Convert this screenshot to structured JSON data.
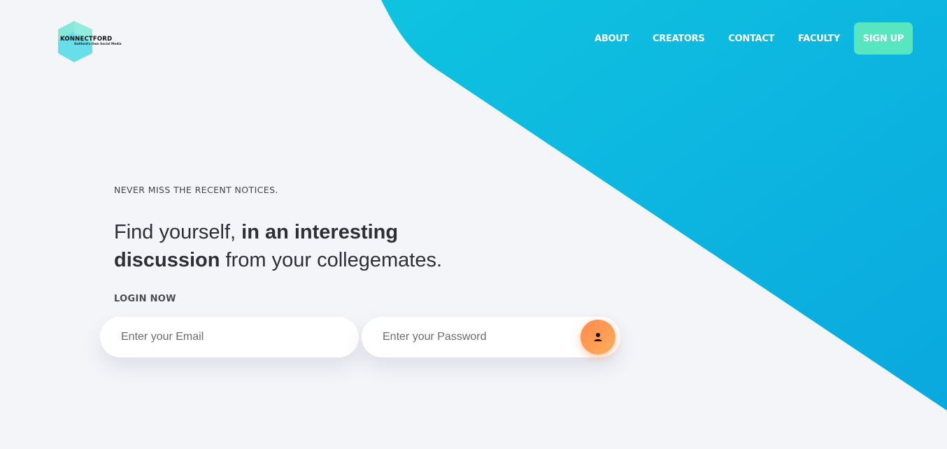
{
  "brand": {
    "name": "KONNECTFORD",
    "tagline": "Gohford's Own Social Media"
  },
  "nav": {
    "items": [
      {
        "label": "ABOUT"
      },
      {
        "label": "CREATORS"
      },
      {
        "label": "CONTACT"
      },
      {
        "label": "FACULTY"
      }
    ],
    "signup_label": "SIGN UP"
  },
  "hero": {
    "eyebrow": "NEVER MISS THE RECENT NOTICES.",
    "headline_part1": "Find yourself, ",
    "headline_bold": "in an interesting discussion",
    "headline_part2": " from your collegemates.",
    "login_label": "LOGIN NOW"
  },
  "login": {
    "email_placeholder": "Enter your Email",
    "password_placeholder": "Enter your Password",
    "submit_icon": "user-icon"
  },
  "colors": {
    "background": "#f4f5f9",
    "accent_gradient_start": "#0fc3e0",
    "accent_gradient_end": "#0aa8df",
    "signup_button": "#58e6c0",
    "login_button": "#ff9a55",
    "text_dark": "#2e2e35"
  }
}
